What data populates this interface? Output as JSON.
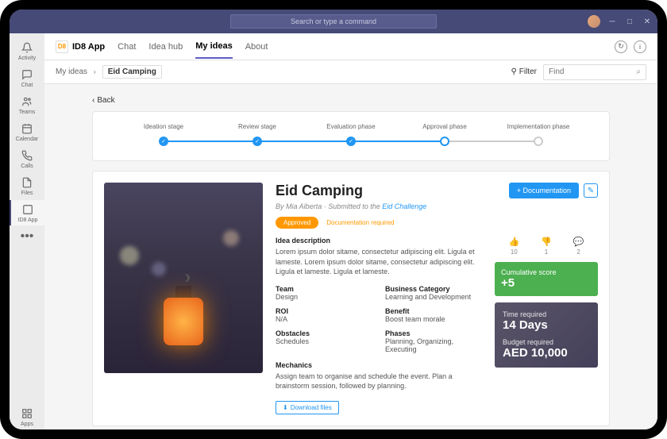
{
  "titlebar": {
    "command_placeholder": "Search or type a command"
  },
  "rail": {
    "items": [
      {
        "label": "Activity",
        "icon": "bell"
      },
      {
        "label": "Chat",
        "icon": "chat"
      },
      {
        "label": "Teams",
        "icon": "teams"
      },
      {
        "label": "Calendar",
        "icon": "calendar"
      },
      {
        "label": "Calls",
        "icon": "calls"
      },
      {
        "label": "Files",
        "icon": "files"
      },
      {
        "label": "ID8 App",
        "icon": "id8",
        "active": true
      }
    ],
    "apps_label": "Apps"
  },
  "apphead": {
    "logo_text": "D8",
    "app_name": "ID8 App",
    "tabs": [
      {
        "label": "Chat"
      },
      {
        "label": "Idea hub"
      },
      {
        "label": "My ideas",
        "active": true
      },
      {
        "label": "About"
      }
    ]
  },
  "subhead": {
    "crumb_root": "My ideas",
    "crumb_current": "Eid Camping",
    "filter_label": "Filter",
    "find_placeholder": "Find"
  },
  "back_label": "Back",
  "stages": [
    {
      "label": "Ideation stage",
      "state": "done"
    },
    {
      "label": "Review stage",
      "state": "done"
    },
    {
      "label": "Evaluation phase",
      "state": "done"
    },
    {
      "label": "Approval phase",
      "state": "pending"
    },
    {
      "label": "Implementation phase",
      "state": "future"
    }
  ],
  "idea": {
    "title": "Eid Camping",
    "author": "Mia Alberta",
    "submitted_prefix": "By ",
    "submitted_mid": " · Submitted to the ",
    "challenge": "Eid Challenge",
    "status_badge": "Approved",
    "doc_required": "Documentation required",
    "doc_button": "+ Documentation",
    "desc_label": "Idea description",
    "desc_text": "Lorem ipsum dolor sitame, consectetur adipiscing elit. Ligula et lameste. Lorem ipsum dolor sitame, consectetur adipiscing elit. Ligula et lameste. Ligula et lameste.",
    "fields": {
      "team_label": "Team",
      "team_value": "Design",
      "category_label": "Business Category",
      "category_value": "Learning and Development",
      "roi_label": "ROI",
      "roi_value": "N/A",
      "benefit_label": "Benefit",
      "benefit_value": "Boost team morale",
      "obstacles_label": "Obstacles",
      "obstacles_value": "Schedules",
      "phases_label": "Phases",
      "phases_value": "Planning, Organizing, Executing",
      "mechanics_label": "Mechanics",
      "mechanics_value": "Assign team to organise and schedule the event. Plan a brainstorm session, followed by planning."
    },
    "download_label": "Download files",
    "reactions": {
      "likes": "10",
      "dislikes": "1",
      "comments": "2"
    },
    "score_label": "Cumulative score",
    "score_value": "+5",
    "time_label": "Time required",
    "time_value": "14 Days",
    "budget_label": "Budget required",
    "budget_value": "AED 10,000"
  }
}
